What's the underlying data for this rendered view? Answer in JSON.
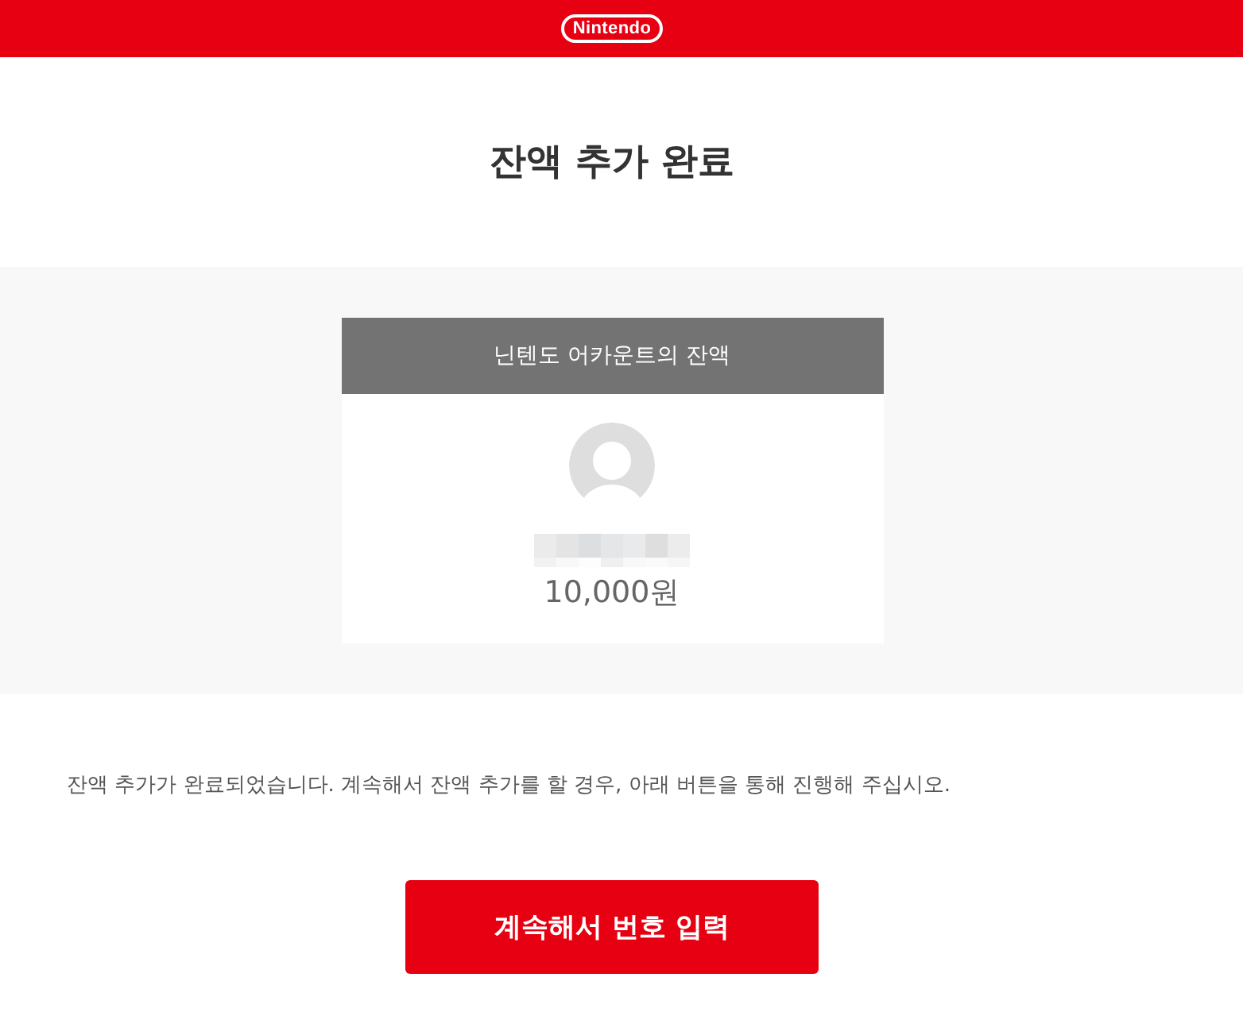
{
  "header": {
    "logo": "Nintendo"
  },
  "title": "잔액 추가 완료",
  "balance_card": {
    "heading": "닌텐도 어카운트의 잔액",
    "amount": "10,000원"
  },
  "message": "잔액 추가가 완료되었습니다. 계속해서 잔액 추가를 할 경우, 아래 버튼을 통해 진행해 주십시오.",
  "button": {
    "label": "계속해서 번호 입력"
  }
}
